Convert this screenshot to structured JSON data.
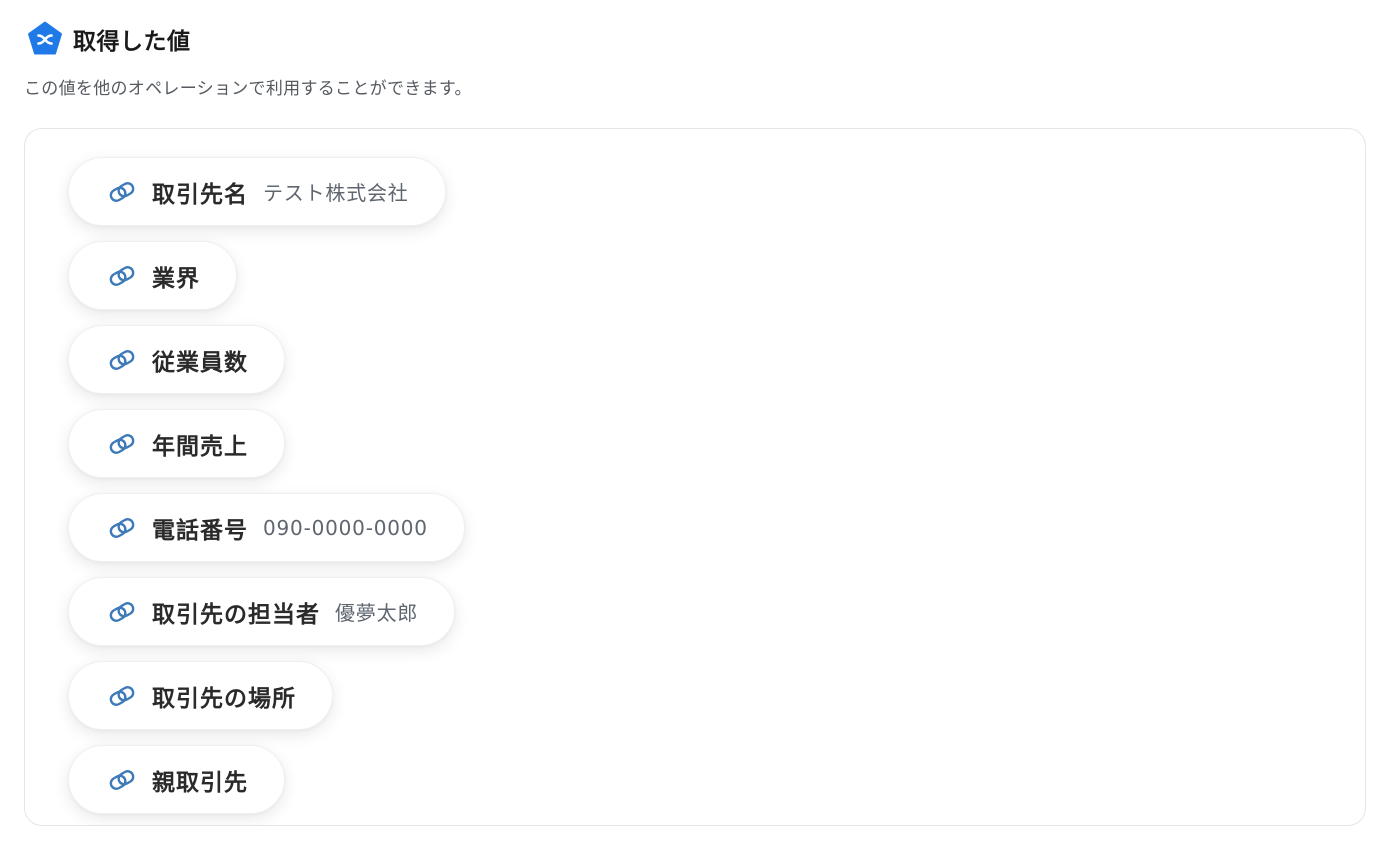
{
  "header": {
    "title": "取得した値",
    "logo_icon": "yoom-pentagon-logo-icon",
    "logo_color": "#1f7ae8"
  },
  "subtitle": "この値を他のオペレーションで利用することができます。",
  "link_icon": "link-chain-icon",
  "link_icon_color": "#3d7ab8",
  "fields": [
    {
      "label": "取引先名",
      "value": "テスト株式会社"
    },
    {
      "label": "業界",
      "value": ""
    },
    {
      "label": "従業員数",
      "value": ""
    },
    {
      "label": "年間売上",
      "value": ""
    },
    {
      "label": "電話番号",
      "value": "090-0000-0000"
    },
    {
      "label": "取引先の担当者",
      "value": "優夢太郎"
    },
    {
      "label": "取引先の場所",
      "value": ""
    },
    {
      "label": "親取引先",
      "value": ""
    }
  ]
}
